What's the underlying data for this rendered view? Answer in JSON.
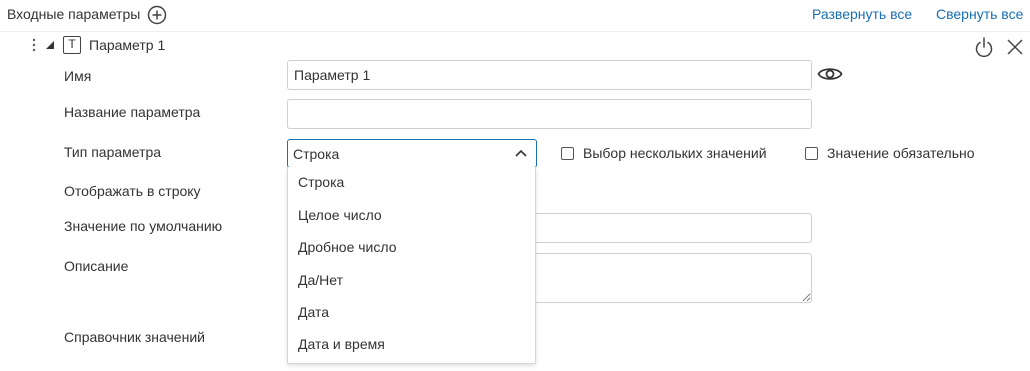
{
  "header": {
    "title": "Входные параметры",
    "expand_all": "Развернуть все",
    "collapse_all": "Свернуть все"
  },
  "parameter": {
    "type_badge": "T",
    "title": "Параметр 1"
  },
  "form": {
    "name_label": "Имя",
    "name_value": "Параметр 1",
    "param_title_label": "Название параметра",
    "param_title_value": "",
    "type_label": "Тип параметра",
    "type_value": "Строка",
    "multi_select_label": "Выбор нескольких значений",
    "required_label": "Значение обязательно",
    "display_in_row_label": "Отображать в строку",
    "default_value_label": "Значение по умолчанию",
    "description_label": "Описание",
    "reference_label": "Справочник значений"
  },
  "dropdown": {
    "options": [
      "Строка",
      "Целое число",
      "Дробное число",
      "Да/Нет",
      "Дата",
      "Дата и время"
    ]
  },
  "colors": {
    "link": "#1a6fb5",
    "select_border": "#1a6fb5",
    "text": "#333333"
  }
}
